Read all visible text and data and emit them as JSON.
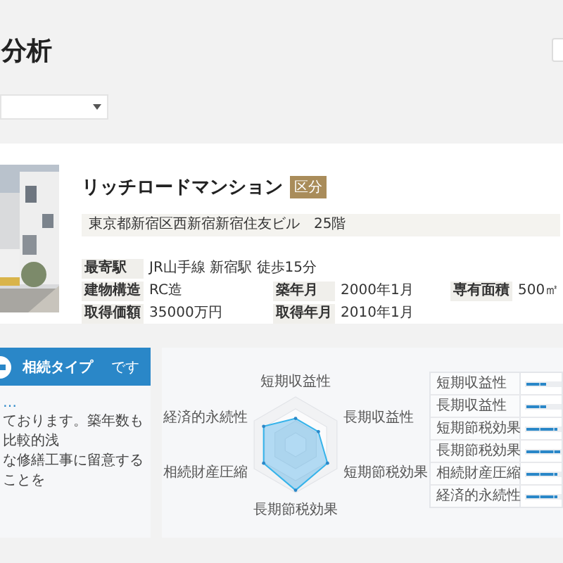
{
  "page_title": "分析",
  "property": {
    "name": "リッチロードマンション",
    "badge": "区分",
    "address": "東京都新宿区西新宿新宿住友ビル　25階",
    "rows": [
      [
        {
          "label": "最寄駅",
          "value": "JR山手線 新宿駅 徒歩15分"
        }
      ],
      [
        {
          "label": "建物構造",
          "value": "RC造"
        },
        {
          "label": "築年月",
          "value": "2000年1月"
        },
        {
          "label": "専有面積",
          "value": "500㎡"
        }
      ],
      [
        {
          "label": "取得価額",
          "value": "35000万円"
        },
        {
          "label": "取得年月",
          "value": "2010年1月"
        }
      ]
    ]
  },
  "type_card": {
    "title": "相続タイプ",
    "suffix": "です",
    "link": "…",
    "lines": [
      "ております。築年数も比較的浅",
      "な修繕工事に留意することを"
    ]
  },
  "radar_labels": [
    "短期収益性",
    "長期収益性",
    "短期節税効果",
    "長期節税効果",
    "相続財産圧縮",
    "経済的永続性"
  ],
  "scores": [
    {
      "label": "短期収益性",
      "level": 0.6
    },
    {
      "label": "長期収益性",
      "level": 0.6
    },
    {
      "label": "短期節税効果",
      "level": 0.9
    },
    {
      "label": "長期節税効果",
      "level": 1.0
    },
    {
      "label": "相続財産圧縮",
      "level": 0.9
    },
    {
      "label": "経済的永続性",
      "level": 0.9
    }
  ]
}
